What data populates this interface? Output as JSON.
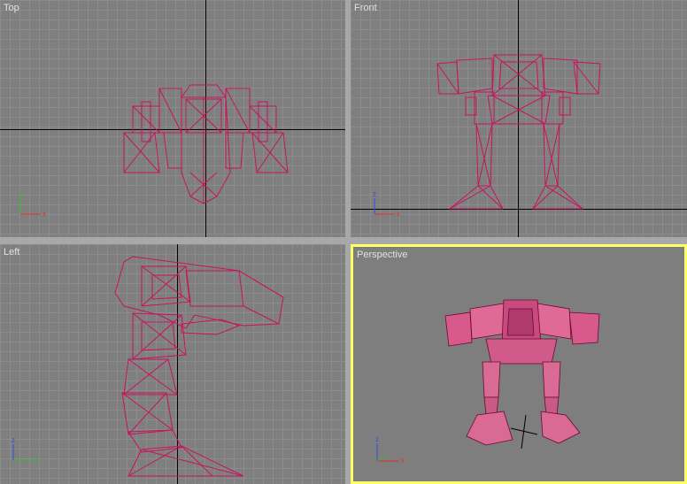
{
  "viewports": {
    "top": {
      "label": "Top"
    },
    "front": {
      "label": "Front"
    },
    "left": {
      "label": "Left"
    },
    "perspective": {
      "label": "Perspective"
    }
  },
  "axis_letters": {
    "x": "x",
    "y": "y",
    "z": "z"
  },
  "colors": {
    "wire": "#c8145a",
    "grid_bg": "#7f7f7f",
    "active_border": "#ffff66",
    "shaded": "#d85a8c"
  }
}
